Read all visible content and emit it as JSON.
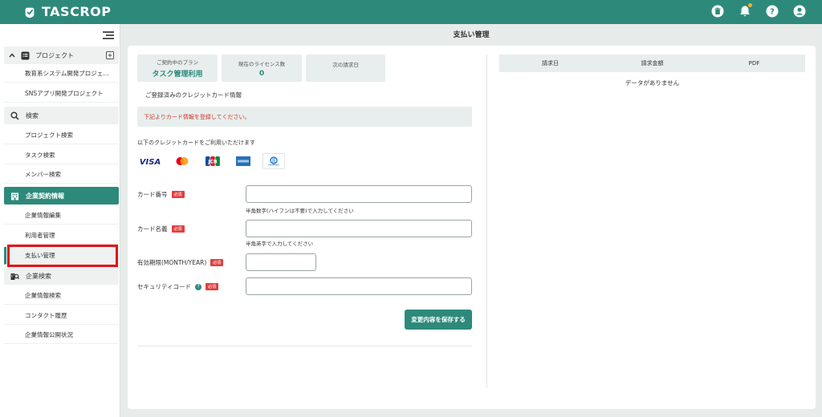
{
  "app": {
    "name": "TASCROP"
  },
  "header": {
    "icons": [
      "trash-icon",
      "bell-icon",
      "help-icon",
      "user-icon"
    ]
  },
  "sidebar": {
    "project": {
      "label": "プロジェクト",
      "items": [
        "教育系システム開発プロジェ…",
        "SNSアプリ開発プロジェクト"
      ]
    },
    "search": {
      "label": "検索",
      "items": [
        "プロジェクト検索",
        "タスク検索",
        "メンバー検索"
      ]
    },
    "company_contract": {
      "label": "企業契約情報",
      "items": [
        "企業情報編集",
        "利用者管理",
        "支払い管理"
      ]
    },
    "company_search": {
      "label": "企業検索",
      "items": [
        "企業情報検索",
        "コンタクト履歴",
        "企業情報公開状況"
      ]
    }
  },
  "page": {
    "title": "支払い管理"
  },
  "plan": {
    "current_plan_label": "ご契約中のプラン",
    "current_plan_value": "タスク管理利用",
    "license_label": "現在のライセンス数",
    "license_value": "0",
    "next_billing_label": "次の請求日",
    "next_billing_value": ""
  },
  "card_section": {
    "registered_title": "ご登録済みのクレジットカード情報",
    "alert": "下記よりカード情報を登録してください。",
    "accepted_label": "以下のクレジットカードをご利用いただけます",
    "brands": [
      "VISA",
      "Mastercard",
      "JCB",
      "AMEX",
      "Diners Club"
    ]
  },
  "form": {
    "required_badge": "必須",
    "card_number_label": "カード番号",
    "card_number_hint": "半角数字(ハイフンは不要)で入力してください",
    "card_name_label": "カード名義",
    "card_name_hint": "半角英字で入力してください",
    "expiry_label": "有効期限(MONTH/YEAR)",
    "security_label": "セキュリティコード",
    "save_label": "変更内容を保存する"
  },
  "invoices": {
    "columns": [
      "請求日",
      "請求金額",
      "PDF"
    ],
    "empty_text": "データがありません"
  },
  "colors": {
    "brand": "#2d8a7b",
    "alert": "#d0392b",
    "highlight": "#e2101a"
  }
}
